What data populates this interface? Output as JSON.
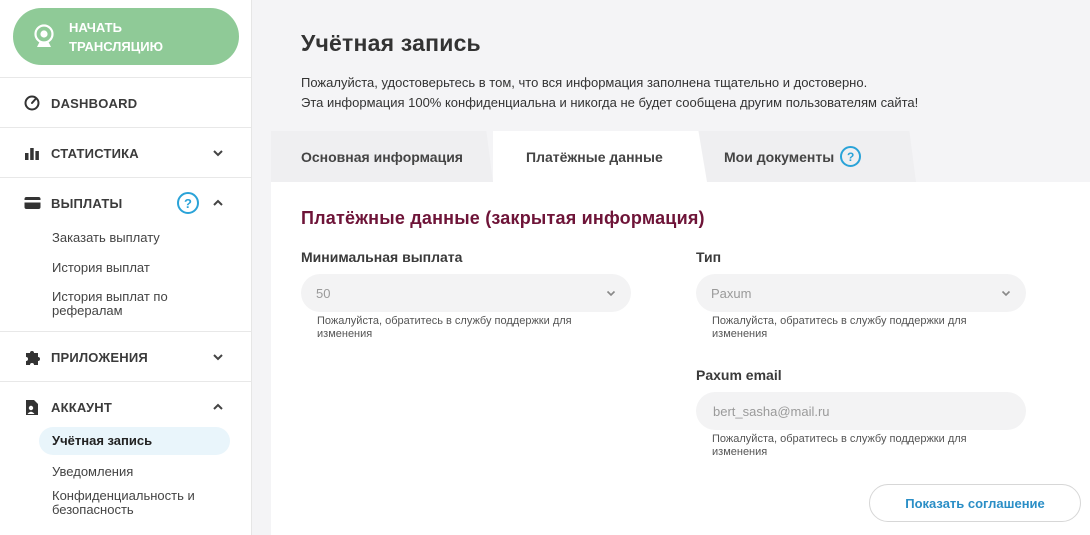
{
  "sidebar": {
    "stream_button": "НАЧАТЬ ТРАНСЛЯЦИЮ",
    "dashboard": "DASHBOARD",
    "statistics": "СТАТИСТИКА",
    "payouts": "ВЫПЛАТЫ",
    "payouts_help": "?",
    "payouts_items": [
      "Заказать выплату",
      "История выплат",
      "История выплат по рефералам"
    ],
    "apps": "ПРИЛОЖЕНИЯ",
    "account": "АККАУНТ",
    "account_items": [
      "Учётная запись",
      "Уведомления",
      "Конфиденциальность и безопасность"
    ],
    "accent_color": "#8fca97",
    "active_item_bg": "#e9f5fb"
  },
  "page": {
    "title": "Учётная запись",
    "intro_line1": "Пожалуйста, удостоверьтесь в том, что вся информация заполнена тщательно и достоверно.",
    "intro_line2": "Эта информация 100% конфиденциальна и никогда не будет сообщена другим пользователям сайта!"
  },
  "tabs": {
    "basic": "Основная информация",
    "payment": "Платёжные данные",
    "documents": "Мои документы",
    "documents_help": "?"
  },
  "payment": {
    "section_title": "Платёжные данные (закрытая информация)",
    "min_payout_label": "Минимальная выплата",
    "min_payout_value": "50",
    "min_payout_hint": "Пожалуйста, обратитесь в службу поддержки для изменения",
    "type_label": "Тип",
    "type_value": "Paxum",
    "type_hint": "Пожалуйста, обратитесь в службу поддержки для изменения",
    "email_label": "Paxum email",
    "email_placeholder": "bert_sasha@mail.ru",
    "email_hint": "Пожалуйста, обратитесь в службу поддержки для изменения",
    "agreement_button": "Показать соглашение"
  },
  "colors": {
    "section_title": "#6e1438",
    "link_blue": "#2a8ec6",
    "help_blue": "#2aa3d8"
  }
}
